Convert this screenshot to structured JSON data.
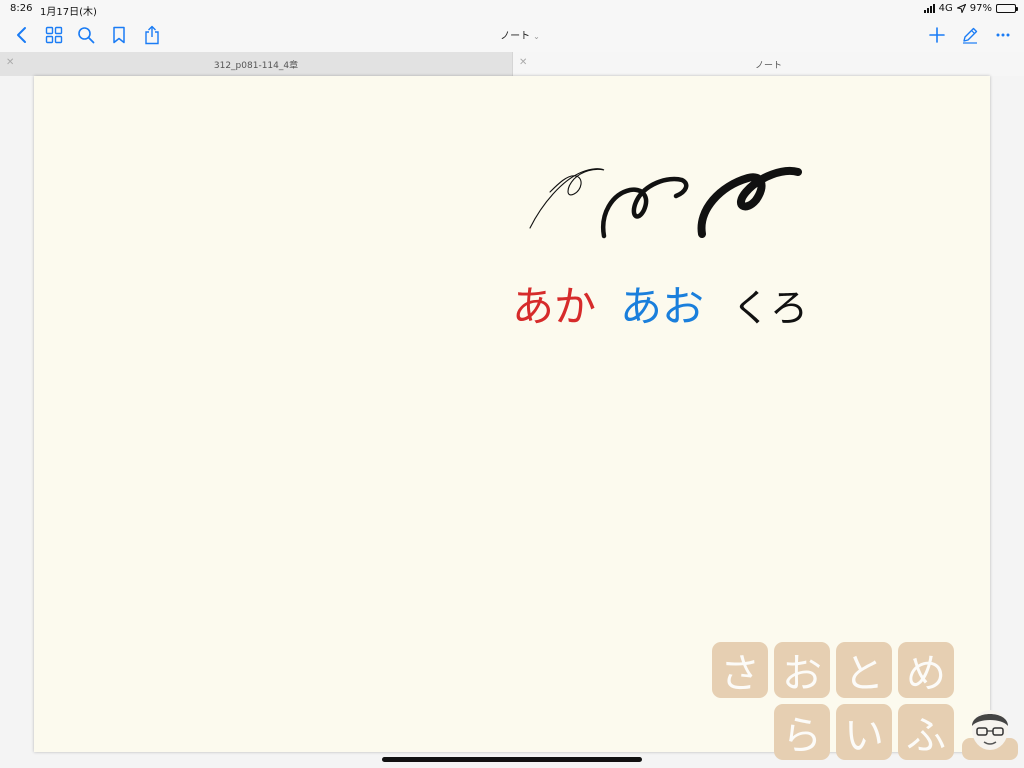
{
  "status": {
    "time": "8:26",
    "date": "1月17日(木)",
    "network": "4G",
    "battery": "97%",
    "battery_level": 0.97
  },
  "toolbar": {
    "title": "ノート"
  },
  "tabs": [
    {
      "label": "312_p081-114_4章",
      "active": true
    },
    {
      "label": "ノート",
      "active": false
    }
  ],
  "note": {
    "handwriting": [
      {
        "text": "あか",
        "color": "#d62b2b"
      },
      {
        "text": "あお",
        "color": "#1a7fdc"
      },
      {
        "text": "くろ",
        "color": "#111111"
      }
    ]
  },
  "watermark": {
    "row1": [
      "さ",
      "お",
      "と",
      "め"
    ],
    "row2": [
      "ら",
      "い",
      "ふ"
    ]
  },
  "colors": {
    "accent": "#1a7cf5",
    "paper": "#fcfaee"
  }
}
